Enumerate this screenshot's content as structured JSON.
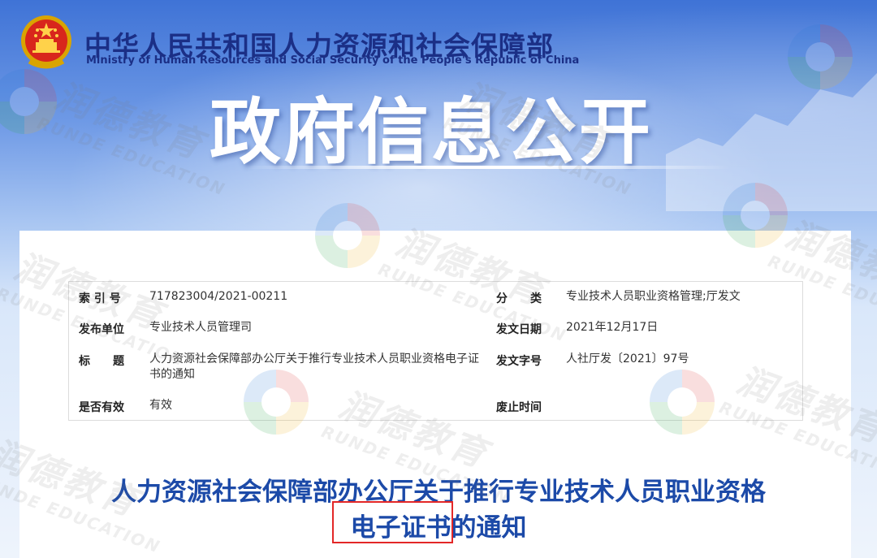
{
  "header": {
    "ministry_cn": "中华人民共和国人力资源和社会保障部",
    "ministry_en": "Ministry of Human Resources and Social Security of the People's Republic of China",
    "banner_title": "政府信息公开",
    "emblem_icon": "national-emblem-icon"
  },
  "meta": {
    "index_label": "索 引 号",
    "index_value": "717823004/2021-00211",
    "category_label": "分　　类",
    "category_value": "专业技术人员职业资格管理;厅发文",
    "issuer_label": "发布单位",
    "issuer_value": "专业技术人员管理司",
    "date_label": "发文日期",
    "date_value": "2021年12月17日",
    "title_label": "标　　题",
    "title_value": "人力资源社会保障部办公厅关于推行专业技术人员职业资格电子证书的通知",
    "docno_label": "发文字号",
    "docno_value": "人社厅发〔2021〕97号",
    "valid_label": "是否有效",
    "valid_value": "有效",
    "abolish_label": "废止时间",
    "abolish_value": ""
  },
  "document": {
    "title_line1": "人力资源社会保障部办公厅关于推行专业技术人员职业资格",
    "title_line2_highlight": "电子证书",
    "title_line2_rest": "的通知"
  },
  "watermark": {
    "cn": "润德教育",
    "en": "RUNDE EDUCATION"
  },
  "colors": {
    "ministry_blue": "#1b2f86",
    "title_blue": "#1c4aa8",
    "highlight_red": "#e32727"
  }
}
